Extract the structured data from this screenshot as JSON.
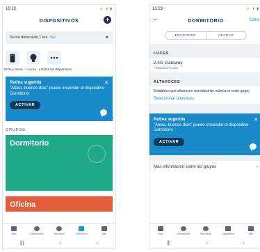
{
  "left": {
    "status": {
      "time": "16:23",
      "icons": "⚡ ▾ ▮"
    },
    "title": "DISPOSITIVOS",
    "notice": {
      "text": "Se ha detectado 1 luz.",
      "link": "Ver"
    },
    "categories": [
      {
        "label": "Echo y Alexa",
        "icon": "echo-icon"
      },
      {
        "label": "• Luces",
        "icon": "bulb-icon"
      },
      {
        "label": "• Todos los dispositivos",
        "icon": "more-icon"
      }
    ],
    "routine": {
      "title": "Rutina sugerida",
      "text": "\"Alexa, buenos días\" puede encender el dispositivo Dormitorio",
      "button": "ACTIVAR"
    },
    "groups_title": "GRUPOS",
    "groups": [
      "Dormitorio",
      "Oficina"
    ]
  },
  "right": {
    "status": {
      "time": "16:23",
      "icons": "⚡ ▾ ▮"
    },
    "title": "DORMITORIO",
    "edit": "Editar",
    "segments": [
      "ENCENDER",
      "APAGAR"
    ],
    "lights": {
      "header": "LUCES",
      "device": "2.4G Gateway",
      "status": "• Dispositivo nuevo"
    },
    "speakers": {
      "header": "ALTAVOCES",
      "text": "Establece qué altavoces reproducirán música en este grupo",
      "link": "Seleccionar altavoces"
    },
    "routine": {
      "title": "Rutina sugerida",
      "text": "\"Alexa, buenos días\" puede encender el dispositivo Dormitorio",
      "button": "ACTIVAR"
    },
    "more_info": "Más información sobre los grupos"
  },
  "tabs": [
    {
      "label": "Inicio",
      "icon": "home-icon"
    },
    {
      "label": "Comunicación",
      "icon": "chat-icon"
    },
    {
      "label": "Reproducir",
      "icon": "play-icon"
    },
    {
      "label": "Dispositivos",
      "icon": "devices-icon"
    },
    {
      "label": "Más",
      "icon": "menu-icon"
    }
  ],
  "nav": [
    "|||",
    "○",
    "‹"
  ],
  "colors": {
    "accent": "#1a98d5",
    "routine": "#1b8ac8",
    "group_dormitorio": "#1fa986",
    "group_oficina": "#e25e3b",
    "dark": "#232f3e"
  }
}
